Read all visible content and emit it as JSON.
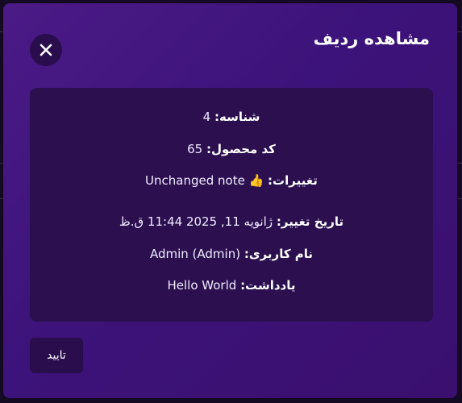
{
  "modal": {
    "title": "مشاهده ردیف",
    "close_icon": "close-icon",
    "confirm_label": "تایید"
  },
  "details": [
    {
      "label": "شناسه:",
      "value": "4"
    },
    {
      "label": "کد محصول:",
      "value": "65"
    },
    {
      "label": "تغییرات:",
      "value": "Unchanged note 👍"
    },
    {
      "label": "تاریخ تغییر:",
      "value": "ژانویه 11, 2025 11:44 ق.ظ"
    },
    {
      "label": "نام کاربری:",
      "value": "Admin (Admin)"
    },
    {
      "label": "یادداشت:",
      "value": "Hello World"
    }
  ],
  "colors": {
    "modal_background": "#3c137a",
    "card_background": "#2b0f4f",
    "button_background": "#2a0d4d",
    "text": "#ffffff"
  }
}
